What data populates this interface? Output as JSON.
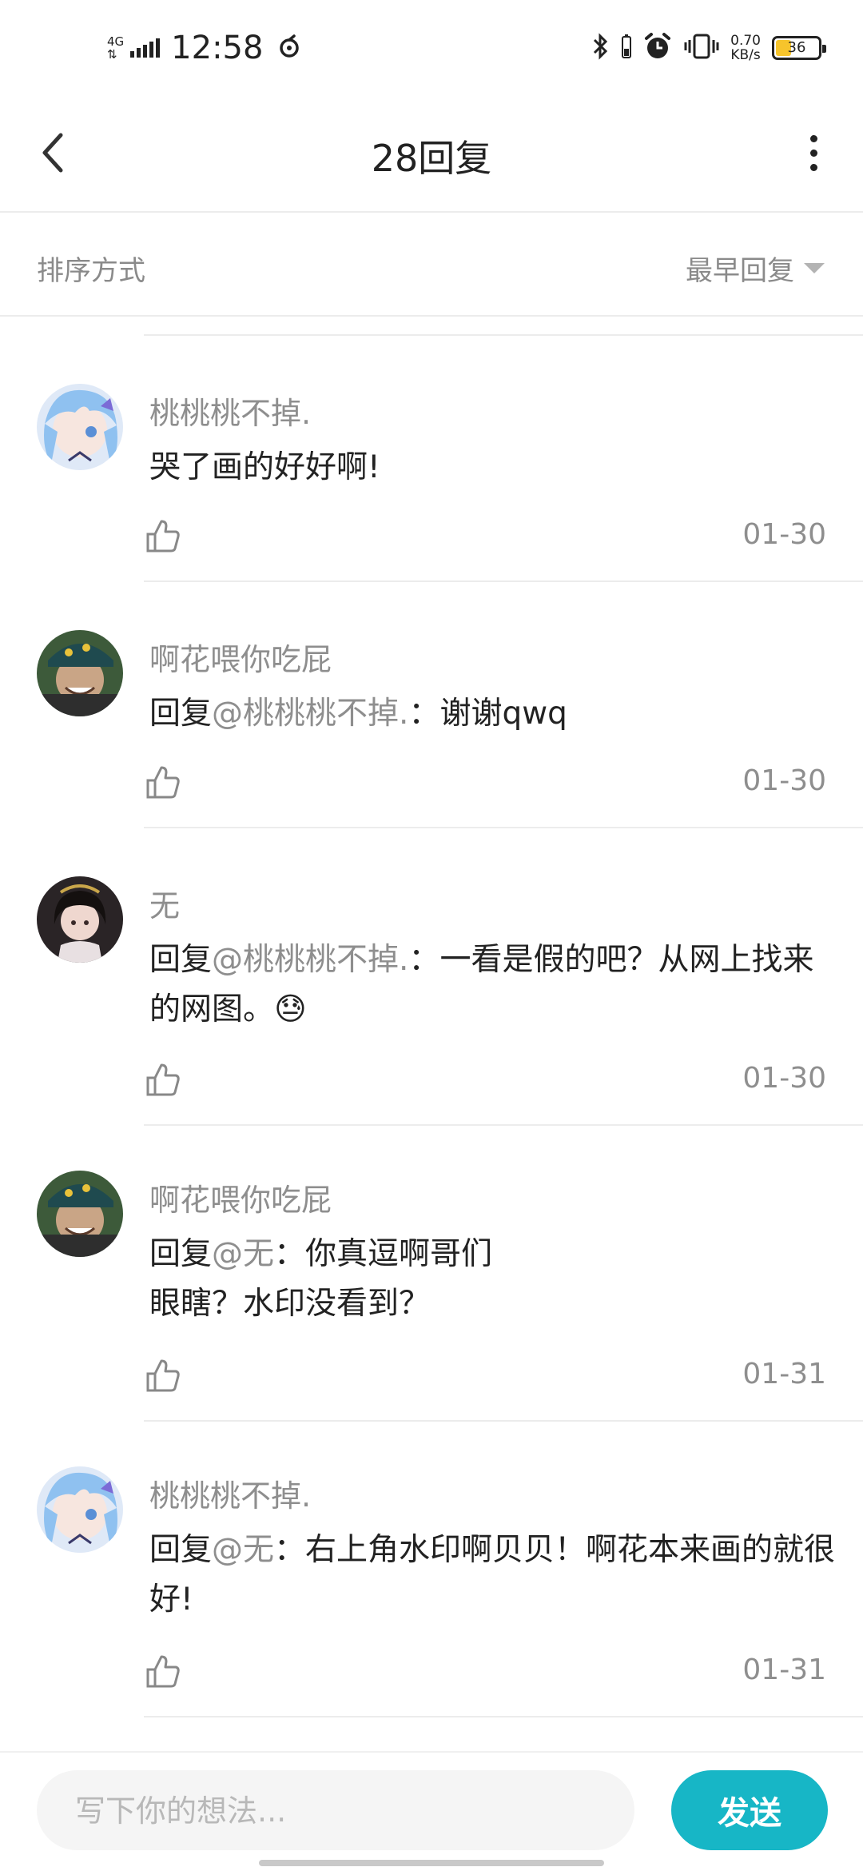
{
  "status_bar": {
    "network": "4G",
    "time": "12:58",
    "speed_value": "0.70",
    "speed_unit": "KB/s",
    "battery": "36",
    "battery_level": 0.36
  },
  "header": {
    "title": "28回复",
    "back_icon": "back-chevron-icon",
    "more_icon": "more-vertical-icon"
  },
  "sort": {
    "label": "排序方式",
    "value": "最早回复"
  },
  "comments": [
    {
      "author": "桃桃桃不掉.",
      "reply_prefix": "",
      "mention": "",
      "separator": "",
      "text": "哭了画的好好啊!",
      "date": "01-30",
      "avatar": "avatar-blue-hair"
    },
    {
      "author": "啊花喂你吃屁",
      "reply_prefix": "回复",
      "mention": "@桃桃桃不掉.",
      "separator": "：",
      "text": "谢谢qwq",
      "date": "01-30",
      "avatar": "avatar-cap"
    },
    {
      "author": "无",
      "reply_prefix": "回复",
      "mention": "@桃桃桃不掉.",
      "separator": "：",
      "text": "一看是假的吧？从网上找来的网图。",
      "emoji": "😓",
      "date": "01-30",
      "avatar": "avatar-dark"
    },
    {
      "author": "啊花喂你吃屁",
      "reply_prefix": "回复",
      "mention": "@无",
      "separator": "：",
      "text": "你真逗啊哥们",
      "text2": "眼瞎？水印没看到？",
      "date": "01-31",
      "avatar": "avatar-cap"
    },
    {
      "author": "桃桃桃不掉.",
      "reply_prefix": "回复",
      "mention": "@无",
      "separator": "：",
      "text": "右上角水印啊贝贝！啊花本来画的就很好!",
      "date": "01-31",
      "avatar": "avatar-blue-hair"
    }
  ],
  "composer": {
    "placeholder": "写下你的想法...",
    "send_label": "发送"
  },
  "colors": {
    "accent": "#17b6c6",
    "muted_text": "#8e8e8e",
    "divider": "#ececec"
  }
}
